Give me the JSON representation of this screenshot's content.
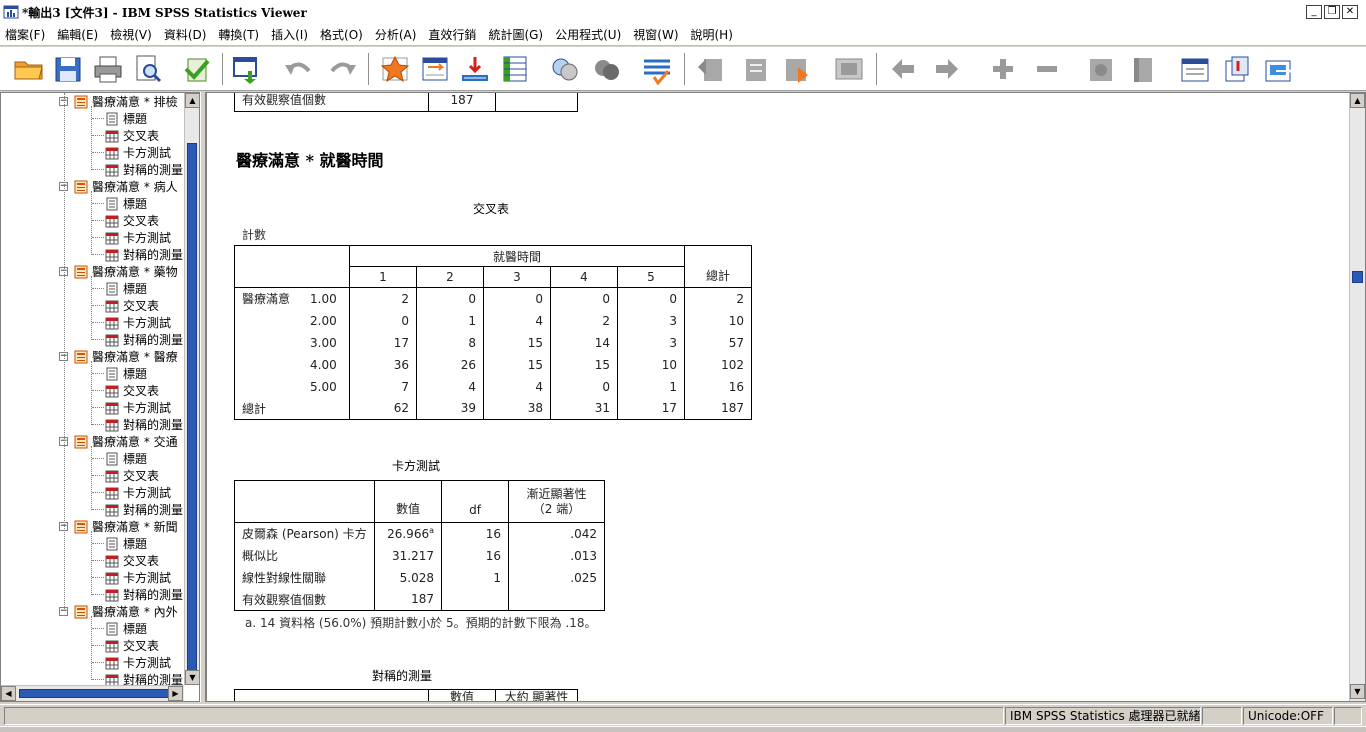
{
  "window": {
    "title": "*輸出3 [文件3] - IBM SPSS Statistics Viewer",
    "controls": [
      "minimize",
      "restore",
      "close"
    ]
  },
  "menu": [
    "檔案(F)",
    "編輯(E)",
    "檢視(V)",
    "資料(D)",
    "轉換(T)",
    "插入(I)",
    "格式(O)",
    "分析(A)",
    "直效行銷",
    "統計圖(G)",
    "公用程式(U)",
    "視窗(W)",
    "說明(H)"
  ],
  "toolbar_icons": [
    "open-folder-icon",
    "save-disk-icon",
    "print-icon",
    "print-preview-icon",
    "export-icon",
    "recall-dialog-icon",
    "undo-icon",
    "redo-icon",
    "goto-data-icon",
    "goto-case-icon",
    "goto-variable-icon",
    "variables-icon",
    "use-sets-icon",
    "show-all-icon",
    "spelling-icon",
    "promote-icon",
    "demote-icon",
    "expand-icon",
    "collapse-icon",
    "show-icon",
    "hide-icon",
    "previous-icon",
    "next-icon",
    "plus-icon",
    "minus-icon",
    "insert-heading-icon",
    "insert-title-icon",
    "insert-text-icon",
    "designate-window-icon",
    "insert-page-icon",
    "export-output-icon"
  ],
  "nav": {
    "groups": [
      {
        "label": "醫療滿意 * 排檢",
        "children": [
          "標題",
          "交叉表",
          "卡方測試",
          "對稱的測量"
        ]
      },
      {
        "label": "醫療滿意 * 病人",
        "children": [
          "標題",
          "交叉表",
          "卡方測試",
          "對稱的測量"
        ]
      },
      {
        "label": "醫療滿意 * 藥物",
        "children": [
          "標題",
          "交叉表",
          "卡方測試",
          "對稱的測量"
        ]
      },
      {
        "label": "醫療滿意 * 醫療",
        "children": [
          "標題",
          "交叉表",
          "卡方測試",
          "對稱的測量"
        ]
      },
      {
        "label": "醫療滿意 * 交通",
        "children": [
          "標題",
          "交叉表",
          "卡方測試",
          "對稱的測量"
        ]
      },
      {
        "label": "醫療滿意 * 新聞",
        "children": [
          "標題",
          "交叉表",
          "卡方測試",
          "對稱的測量"
        ]
      },
      {
        "label": "醫療滿意 * 內外",
        "children": [
          "標題",
          "交叉表",
          "卡方測試",
          "對稱的測量"
        ]
      }
    ]
  },
  "output": {
    "prev_table_row": {
      "label": "有效觀察值個數",
      "value": "187"
    },
    "heading": "醫療滿意 * 就醫時間",
    "crosstab": {
      "title": "交叉表",
      "caption": "計數",
      "col_var": "就醫時間",
      "col_headers": [
        "1",
        "2",
        "3",
        "4",
        "5"
      ],
      "total_header": "總計",
      "row_var": "醫療滿意",
      "rows": [
        {
          "label": "1.00",
          "values": [
            "2",
            "0",
            "0",
            "0",
            "0"
          ],
          "total": "2"
        },
        {
          "label": "2.00",
          "values": [
            "0",
            "1",
            "4",
            "2",
            "3"
          ],
          "total": "10"
        },
        {
          "label": "3.00",
          "values": [
            "17",
            "8",
            "15",
            "14",
            "3"
          ],
          "total": "57"
        },
        {
          "label": "4.00",
          "values": [
            "36",
            "26",
            "15",
            "15",
            "10"
          ],
          "total": "102"
        },
        {
          "label": "5.00",
          "values": [
            "7",
            "4",
            "4",
            "0",
            "1"
          ],
          "total": "16"
        }
      ],
      "total_row": {
        "label": "總計",
        "values": [
          "62",
          "39",
          "38",
          "31",
          "17"
        ],
        "total": "187"
      }
    },
    "chisq": {
      "title": "卡方測試",
      "headers": {
        "value": "數值",
        "df": "df",
        "sig_line1": "漸近顯著性",
        "sig_line2": "（2 端）"
      },
      "rows": [
        {
          "label": "皮爾森 (Pearson) 卡方",
          "value": "26.966",
          "sup": "a",
          "df": "16",
          "sig": ".042"
        },
        {
          "label": "概似比",
          "value": "31.217",
          "sup": "",
          "df": "16",
          "sig": ".013"
        },
        {
          "label": "線性對線性關聯",
          "value": "5.028",
          "sup": "",
          "df": "1",
          "sig": ".025"
        },
        {
          "label": "有效觀察值個數",
          "value": "187",
          "sup": "",
          "df": "",
          "sig": ""
        }
      ],
      "footnote": "a. 14 資料格 (56.0%) 預期計數小於 5。預期的計數下限為 .18。"
    },
    "symmetric": {
      "title": "對稱的測量",
      "headers": [
        "數值",
        "大約 顯著性"
      ]
    }
  },
  "status": {
    "processor": "IBM SPSS Statistics 處理器已就緒",
    "encoding": "Unicode:OFF"
  }
}
